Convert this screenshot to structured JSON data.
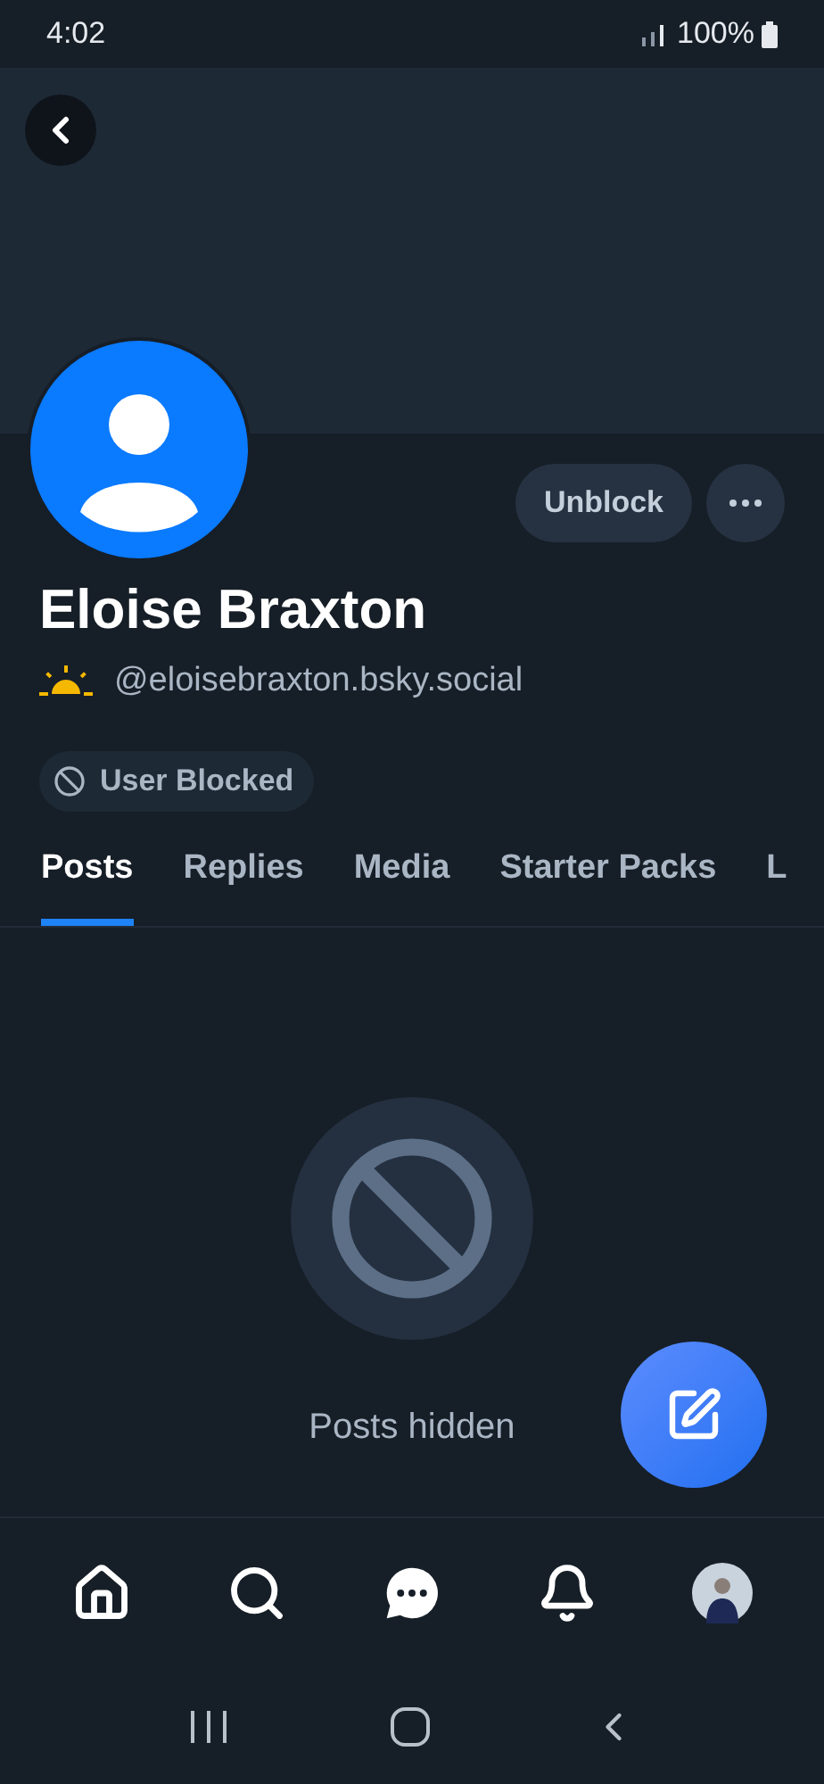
{
  "status_bar": {
    "time": "4:02",
    "battery": "100%"
  },
  "profile": {
    "name": "Eloise Braxton",
    "handle": "@eloisebraxton.bsky.social",
    "badge": "User Blocked",
    "unblock_button": "Unblock"
  },
  "tabs": [
    {
      "label": "Posts",
      "selected": true
    },
    {
      "label": "Replies",
      "selected": false
    },
    {
      "label": "Media",
      "selected": false
    },
    {
      "label": "Starter Packs",
      "selected": false
    },
    {
      "label": "L",
      "selected": false
    }
  ],
  "empty_state": {
    "message": "Posts hidden"
  },
  "bottom_nav": [
    {
      "kind": "home"
    },
    {
      "kind": "search"
    },
    {
      "kind": "chat"
    },
    {
      "kind": "bell"
    },
    {
      "kind": "avatar"
    }
  ]
}
